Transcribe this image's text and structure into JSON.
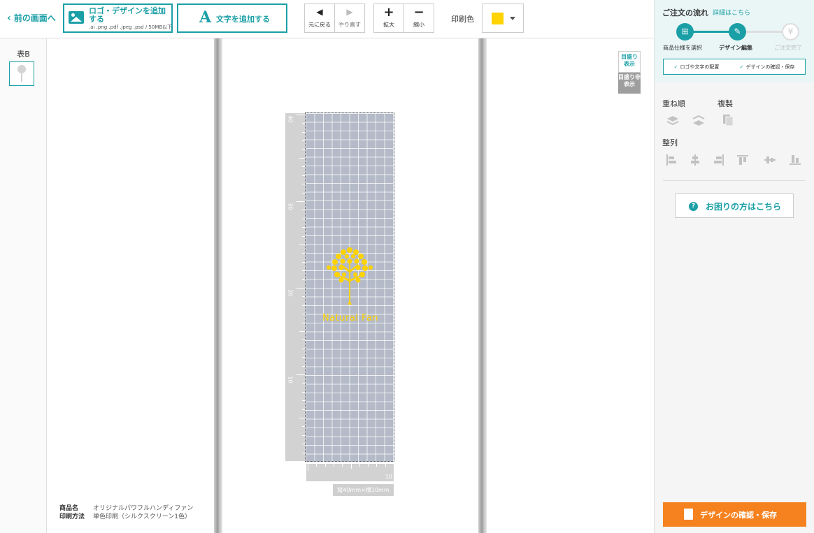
{
  "toolbar": {
    "back_label": "前の画面へ",
    "logo_button_label": "ロゴ・デザインを追加する",
    "logo_button_sub": ".ai .png .pdf .jpeg .psd / 50MB以下",
    "text_button_icon": "A",
    "text_button_label": "文字を追加する",
    "undo_label": "元に戻る",
    "redo_label": "やり直す",
    "zoom_in_label": "拡大",
    "zoom_out_label": "縮小",
    "print_color_label": "印刷色",
    "print_color_value": "#ffd300"
  },
  "side_panel": {
    "face_label": "表B"
  },
  "canvas": {
    "ruler_v_labels": [
      "40",
      "30",
      "20",
      "10"
    ],
    "ruler_h_label": "10",
    "logo_text": "Natural Fan",
    "size_label": "縦40mm×横10mm",
    "grid_show_label": "目盛り表示",
    "grid_hide_label": "目盛り非表示",
    "product_name_key": "商品名",
    "product_name_value": "オリジナルパワフルハンディファン",
    "print_method_key": "印刷方法",
    "print_method_value": "単色印刷（シルクスクリーン1色）"
  },
  "right_panel": {
    "flow_title": "ご注文の流れ",
    "flow_detail_link": "詳細はこちら",
    "steps": [
      {
        "label": "商品仕様を選択",
        "icon": "gift-icon"
      },
      {
        "label": "デザイン編集",
        "icon": "pencil-icon"
      },
      {
        "label": "ご注文完了",
        "icon": "yen-icon"
      }
    ],
    "sub_steps": [
      "ロゴや文字の配置",
      "デザインの確認・保存"
    ],
    "layer_order_label": "重ね順",
    "duplicate_label": "複製",
    "align_label": "整列",
    "help_label": "お困りの方はこちら",
    "confirm_label": "デザインの確認・保存"
  },
  "colors": {
    "accent": "#1a9fa6",
    "cta": "#f5821f",
    "print_color": "#ffd300"
  }
}
